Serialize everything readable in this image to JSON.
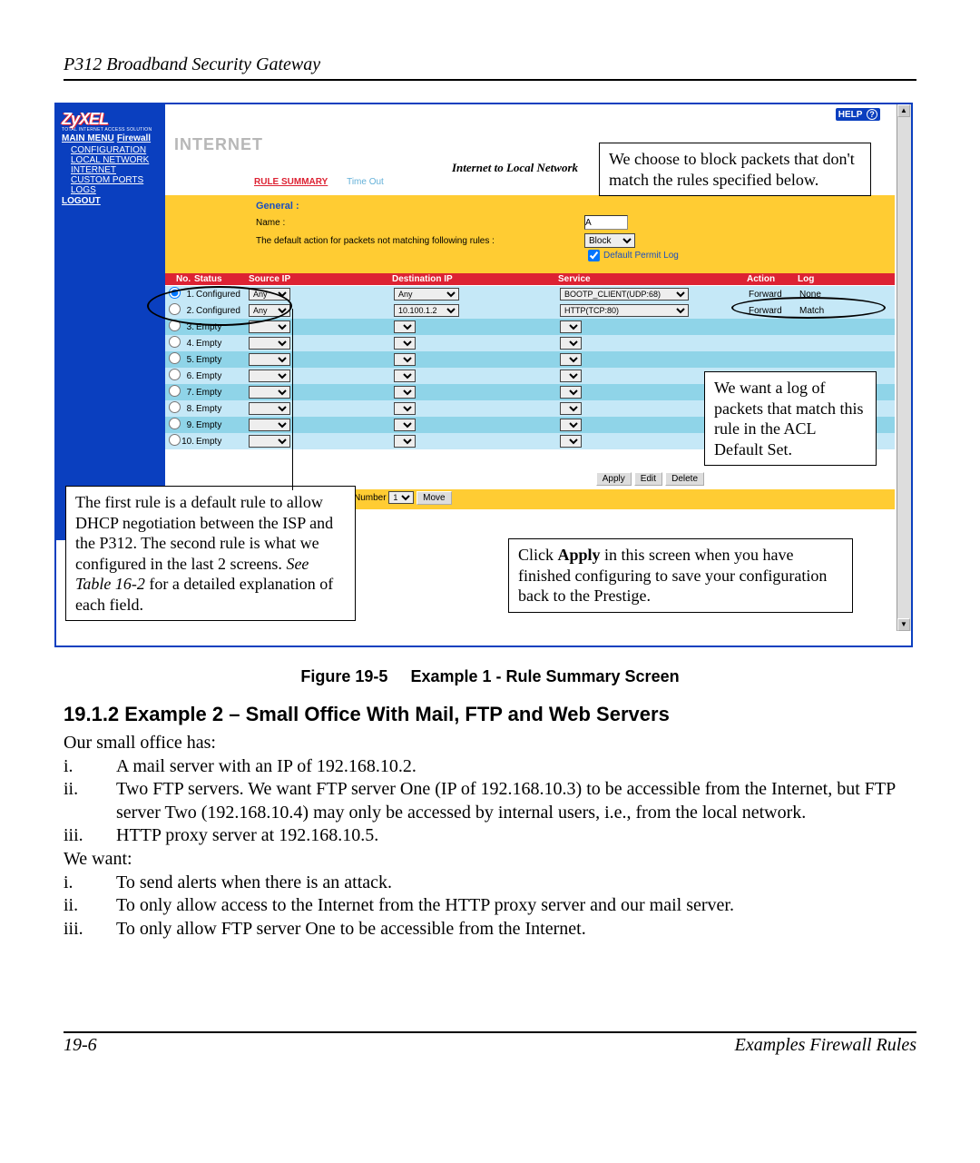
{
  "doc_header": "P312  Broadband Security Gateway",
  "brand": {
    "name": "ZyXEL",
    "tagline": "TOTAL INTERNET ACCESS SOLUTION"
  },
  "help_label": "HELP",
  "sidebar": {
    "main_menu": "MAIN MENU",
    "firewall": "Firewall",
    "items": [
      "CONFIGURATION",
      "LOCAL NETWORK",
      "INTERNET",
      "CUSTOM PORTS",
      "LOGS"
    ],
    "logout": "LOGOUT"
  },
  "page": {
    "title": "INTERNET",
    "subtitle": "Internet to Local Network",
    "tabs": {
      "rule_summary": "RULE SUMMARY",
      "timeout": "Time Out"
    },
    "general": {
      "heading": "General :",
      "name_label": "Name :",
      "name_value": "A",
      "default_action_text": "The default action for packets not matching following rules :",
      "default_action_value": "Block",
      "permit_log_label": "Default Permit Log",
      "permit_log_checked": true
    },
    "columns": {
      "no": "No.",
      "status": "Status",
      "src": "Source IP",
      "dst": "Destination IP",
      "svc": "Service",
      "action": "Action",
      "log": "Log"
    },
    "rules": [
      {
        "no": "1.",
        "status": "Configured",
        "src": "Any",
        "dst": "Any",
        "svc": "BOOTP_CLIENT(UDP:68)",
        "action": "Forward",
        "log": "None"
      },
      {
        "no": "2.",
        "status": "Configured",
        "src": "Any",
        "dst": "10.100.1.2",
        "svc": "HTTP(TCP:80)",
        "action": "Forward",
        "log": "Match"
      },
      {
        "no": "3.",
        "status": "Empty",
        "src": "",
        "dst": "",
        "svc": "",
        "action": "",
        "log": ""
      },
      {
        "no": "4.",
        "status": "Empty",
        "src": "",
        "dst": "",
        "svc": "",
        "action": "",
        "log": ""
      },
      {
        "no": "5.",
        "status": "Empty",
        "src": "",
        "dst": "",
        "svc": "",
        "action": "",
        "log": ""
      },
      {
        "no": "6.",
        "status": "Empty",
        "src": "",
        "dst": "",
        "svc": "",
        "action": "",
        "log": ""
      },
      {
        "no": "7.",
        "status": "Empty",
        "src": "",
        "dst": "",
        "svc": "",
        "action": "",
        "log": ""
      },
      {
        "no": "8.",
        "status": "Empty",
        "src": "",
        "dst": "",
        "svc": "",
        "action": "",
        "log": ""
      },
      {
        "no": "9.",
        "status": "Empty",
        "src": "",
        "dst": "",
        "svc": "",
        "action": "",
        "log": ""
      },
      {
        "no": "10.",
        "status": "Empty",
        "src": "",
        "dst": "",
        "svc": "",
        "action": "",
        "log": ""
      }
    ],
    "buttons": {
      "apply": "Apply",
      "edit": "Edit",
      "delete": "Delete",
      "move": "Move",
      "number_label": "Number",
      "number_value": "1"
    }
  },
  "callouts": {
    "block": "We choose to block packets that don't match the rules specified below.",
    "log": "We want a log of packets that match this rule in the ACL Default Set.",
    "first_rule": "The first rule is a default rule to allow DHCP negotiation between the ISP and the P312. The second rule is what we configured in the last 2 screens. See Table 16-2 for a detailed explanation of each field.",
    "first_rule_plain_a": "The first rule is a default rule to allow DHCP negotiation between the ISP and the P312. The second rule is what we configured in the last 2 screens. ",
    "first_rule_italic": "See Table 16-2",
    "first_rule_plain_b": " for a detailed explanation of each field.",
    "apply_a": "Click ",
    "apply_bold": "Apply",
    "apply_b": " in this screen when you have finished configuring to save your configuration back to the Prestige."
  },
  "caption_label": "Figure 19-5",
  "caption_text": "Example 1 - Rule Summary Screen",
  "section_heading": "19.1.2 Example 2 – Small Office With Mail, FTP and Web Servers",
  "paragraphs": {
    "intro": "Our small office has:",
    "list1": [
      "A mail server with an IP of 192.168.10.2.",
      "Two FTP servers. We want FTP server One (IP of 192.168.10.3) to be accessible from the Internet, but FTP server Two (192.168.10.4) may only be accessed by internal users, i.e., from the local network.",
      "HTTP proxy server at 192.168.10.5."
    ],
    "wewant": "We want:",
    "list2": [
      "To send alerts when there is an attack.",
      "To only allow access to the Internet from the HTTP proxy server and our mail server.",
      "To only allow FTP server One to be accessible from the Internet."
    ]
  },
  "footer": {
    "page": "19-6",
    "section": "Examples Firewall Rules"
  }
}
